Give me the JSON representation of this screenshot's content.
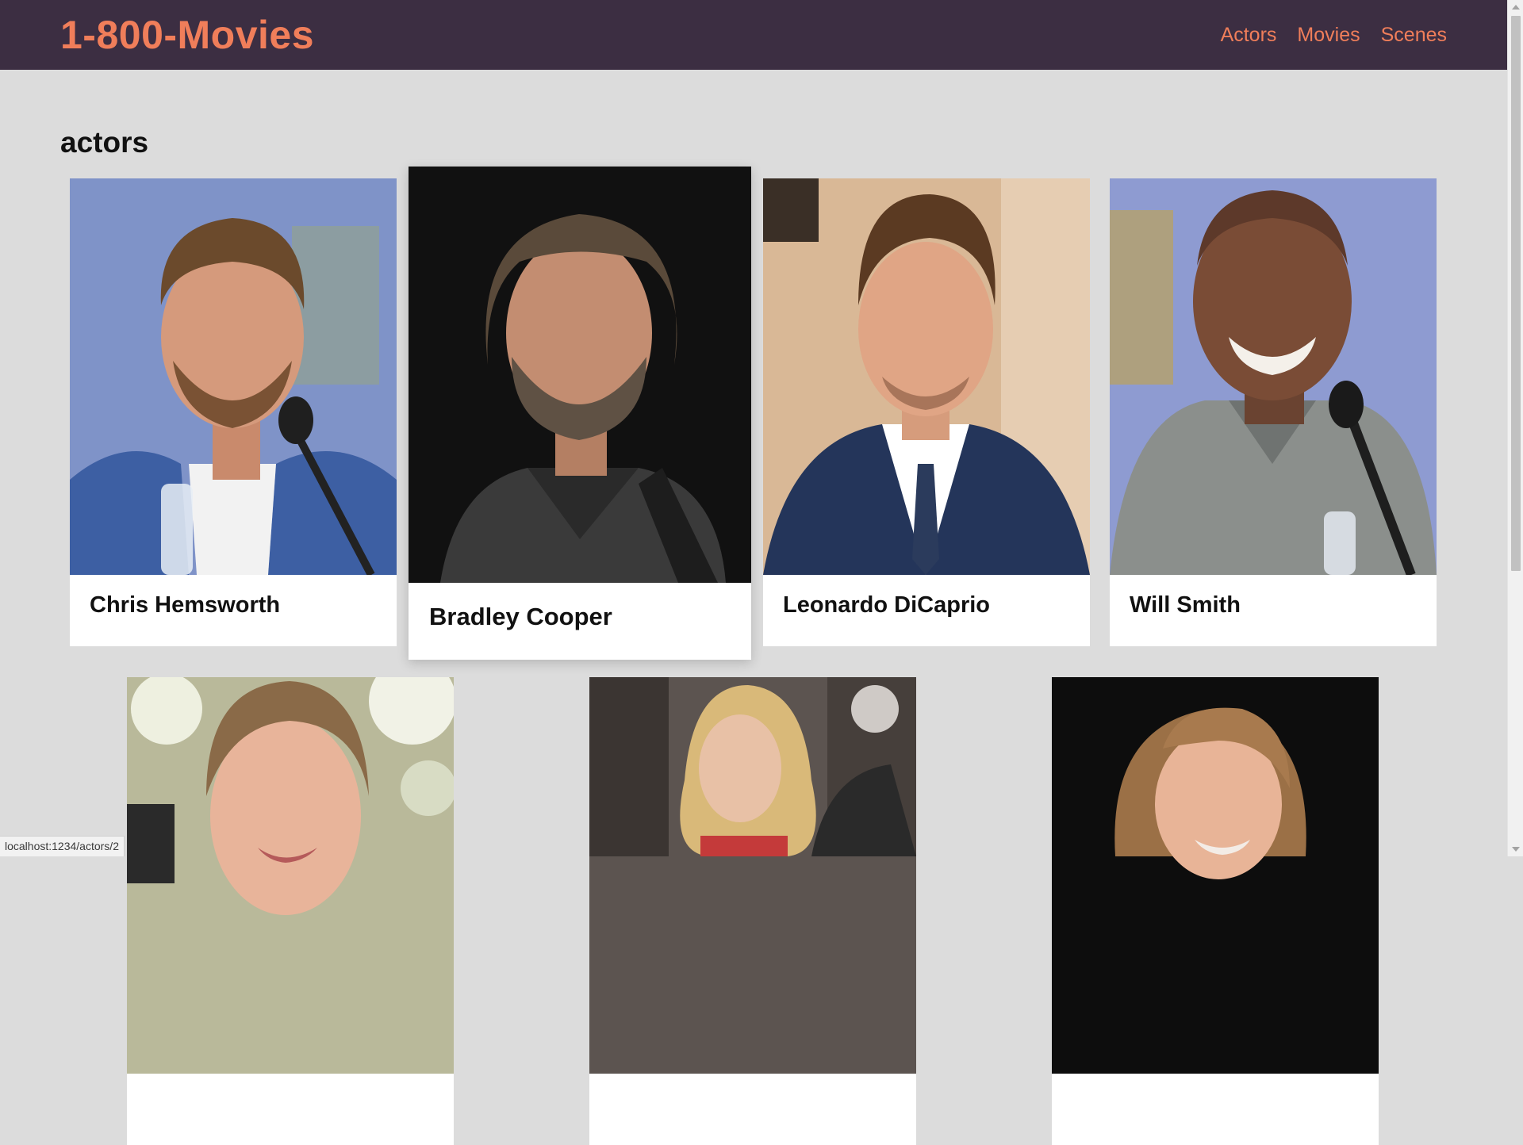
{
  "navbar": {
    "brand": "1-800-Movies",
    "links": [
      {
        "label": "Actors"
      },
      {
        "label": "Movies"
      },
      {
        "label": "Scenes"
      }
    ]
  },
  "page": {
    "heading": "actors"
  },
  "actors": [
    {
      "name": "Chris Hemsworth"
    },
    {
      "name": "Bradley Cooper"
    },
    {
      "name": "Leonardo DiCaprio"
    },
    {
      "name": "Will Smith"
    },
    {
      "name": ""
    },
    {
      "name": ""
    },
    {
      "name": ""
    }
  ],
  "status_bar": {
    "url": "localhost:1234/actors/2"
  },
  "colors": {
    "navbar_bg": "#3c2e42",
    "accent": "#f07e5a",
    "page_bg": "#dcdcdc",
    "card_bg": "#ffffff"
  }
}
